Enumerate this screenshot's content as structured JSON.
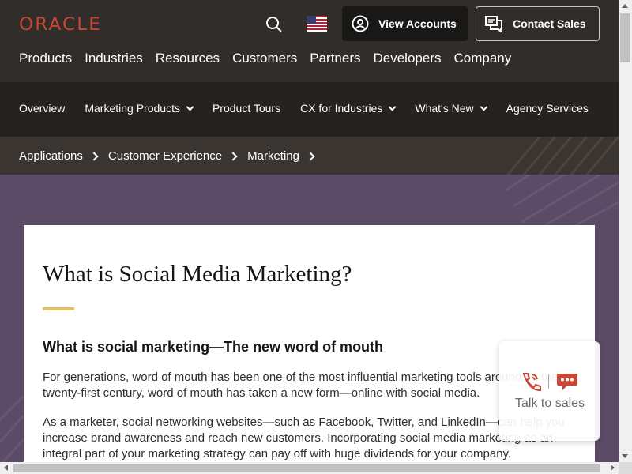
{
  "header": {
    "logo": "ORACLE",
    "search_icon": "search-icon",
    "flag_icon": "us-flag-icon",
    "view_accounts": "View Accounts",
    "contact_sales": "Contact Sales",
    "nav": [
      "Products",
      "Industries",
      "Resources",
      "Customers",
      "Partners",
      "Developers",
      "Company"
    ]
  },
  "subnav": {
    "items": [
      {
        "label": "Overview",
        "dropdown": false
      },
      {
        "label": "Marketing Products",
        "dropdown": true
      },
      {
        "label": "Product Tours",
        "dropdown": false
      },
      {
        "label": "CX for Industries",
        "dropdown": true
      },
      {
        "label": "What's New",
        "dropdown": true
      },
      {
        "label": "Agency Services",
        "dropdown": false
      }
    ]
  },
  "breadcrumb": [
    "Applications",
    "Customer Experience",
    "Marketing"
  ],
  "article": {
    "title": "What is Social Media Marketing?",
    "subtitle": "What is social marketing—The new word of mouth",
    "p1": "For generations, word of mouth has been one of the most influential marketing tools around. In the twenty-first century, word of mouth has taken a new form—online with social media.",
    "p2": "As a marketer, social networking websites—such as Facebook, Twitter, and LinkedIn—can help you increase brand awareness and reach new customers. Incorporating social media marketing as an integral part of your marketing strategy can pay off with huge dividends for your company."
  },
  "widget": {
    "label": "Talk to sales",
    "icons": [
      "phone-icon",
      "chat-icon"
    ]
  },
  "colors": {
    "header_bg": "#312d2a",
    "subnav_bg": "#26221f",
    "breadcrumb_bg": "#3b3531",
    "hero_bg": "#5b4b66",
    "brand_red": "#c74634",
    "accent_gold": "#e2c05a"
  }
}
